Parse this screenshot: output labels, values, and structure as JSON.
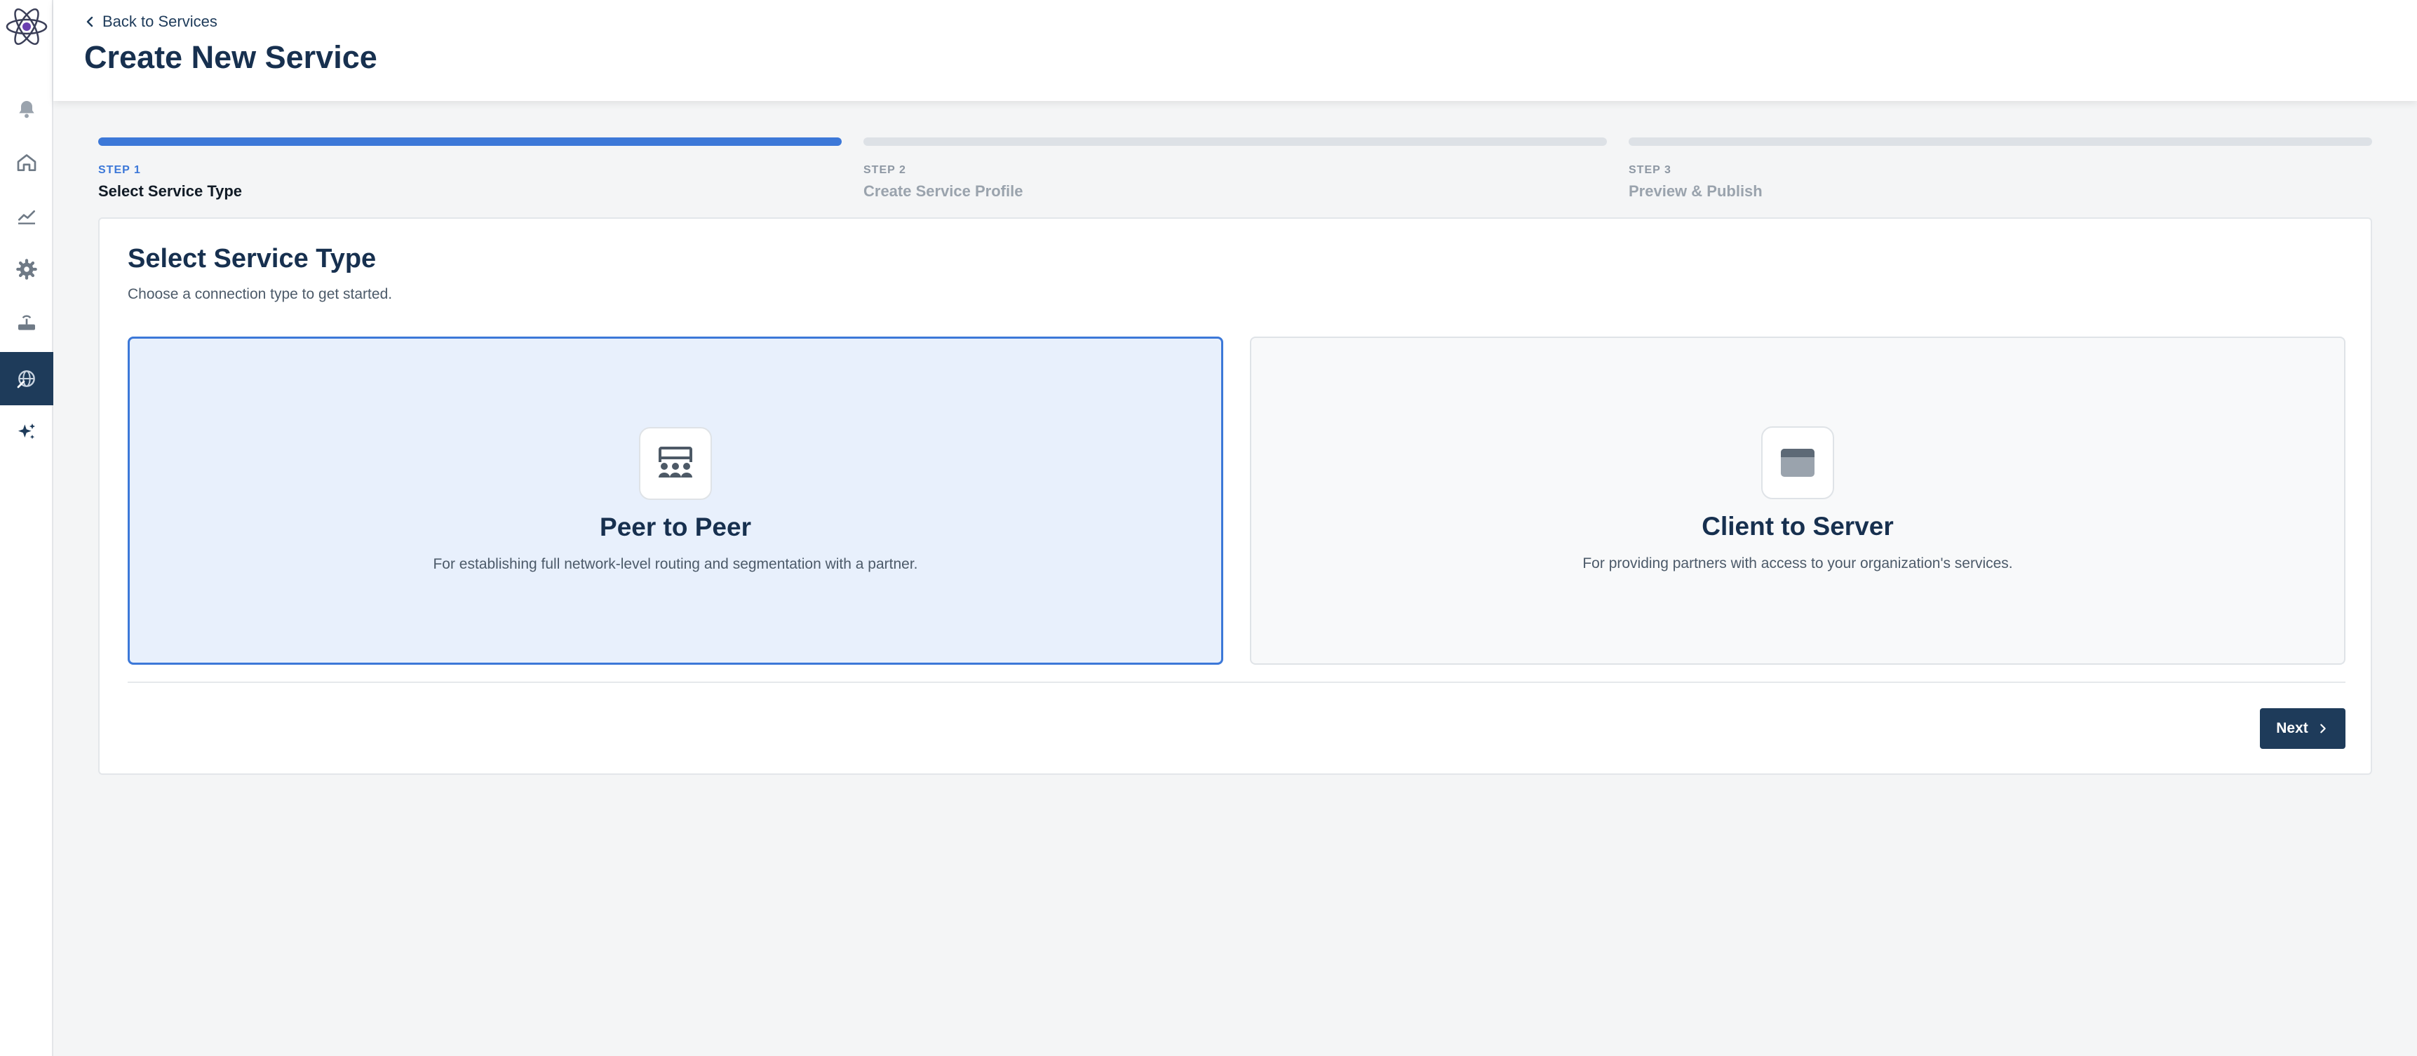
{
  "colors": {
    "accent": "#3c78d8",
    "brand_dark": "#1e3b5a",
    "selected_bg": "#e8f0fc"
  },
  "sidebar": {
    "logo": "atom-logo-icon",
    "items": [
      {
        "icon": "bell-icon",
        "active": false
      },
      {
        "icon": "home-icon",
        "active": false
      },
      {
        "icon": "chart-line-icon",
        "active": false
      },
      {
        "icon": "gear-icon",
        "active": false
      },
      {
        "icon": "router-icon",
        "active": false
      },
      {
        "icon": "globe-network-icon",
        "active": true
      },
      {
        "icon": "sparkles-icon",
        "active": false
      }
    ]
  },
  "header": {
    "back_link": "Back to Services",
    "title": "Create New Service"
  },
  "stepper": {
    "steps": [
      {
        "num": "STEP 1",
        "label": "Select Service Type",
        "active": true
      },
      {
        "num": "STEP 2",
        "label": "Create Service Profile",
        "active": false
      },
      {
        "num": "STEP 3",
        "label": "Preview & Publish",
        "active": false
      }
    ]
  },
  "card": {
    "title": "Select Service Type",
    "subtitle": "Choose a connection type to get started.",
    "options": [
      {
        "icon": "peer-group-icon",
        "title": "Peer to Peer",
        "description": "For establishing full network-level routing and segmentation with a partner.",
        "selected": true
      },
      {
        "icon": "server-window-icon",
        "title": "Client to Server",
        "description": "For providing partners with access to your organization's services.",
        "selected": false
      }
    ],
    "next_label": "Next"
  }
}
